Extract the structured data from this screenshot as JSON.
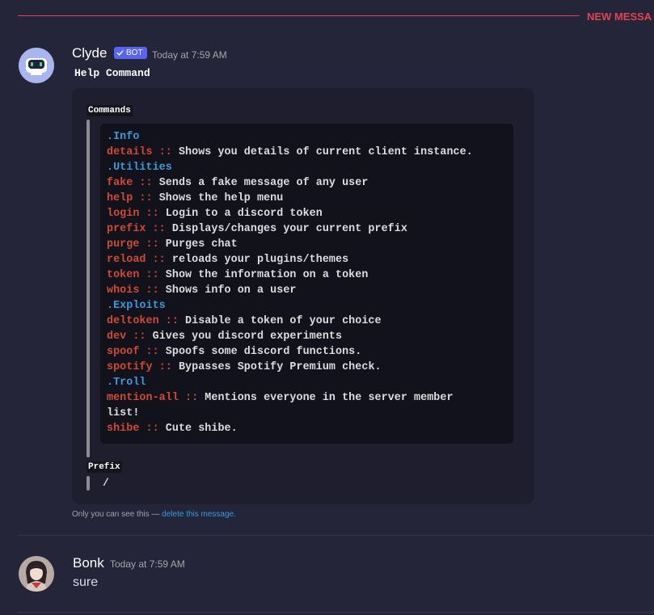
{
  "divider": {
    "label": "NEW MESSA"
  },
  "messages": {
    "bot": {
      "username": "Clyde",
      "badge": "BOT",
      "timestamp": "Today at 7:59 AM",
      "title": "Help Command",
      "embed": {
        "fields": {
          "commands": "Commands",
          "prefix": "Prefix"
        },
        "prefix_value": "/",
        "lines": [
          {
            "kind": "category",
            "text": ".Info"
          },
          {
            "kind": "command",
            "cmd": "details",
            "sep": " :: ",
            "desc": "Shows you details of current client instance."
          },
          {
            "kind": "category",
            "text": ".Utilities"
          },
          {
            "kind": "command",
            "cmd": "fake",
            "sep": " :: ",
            "desc": "Sends a fake message of any user"
          },
          {
            "kind": "command",
            "cmd": "help",
            "sep": " :: ",
            "desc": "Shows the help menu"
          },
          {
            "kind": "command",
            "cmd": "login",
            "sep": " :: ",
            "desc": "Login to a discord token"
          },
          {
            "kind": "command",
            "cmd": "prefix",
            "sep": " :: ",
            "desc": "Displays/changes your current prefix"
          },
          {
            "kind": "command",
            "cmd": "purge",
            "sep": " :: ",
            "desc": "Purges chat"
          },
          {
            "kind": "command",
            "cmd": "reload",
            "sep": " :: ",
            "desc": "reloads your plugins/themes"
          },
          {
            "kind": "command",
            "cmd": "token",
            "sep": " :: ",
            "desc": "Show the information on a token"
          },
          {
            "kind": "command",
            "cmd": "whois",
            "sep": " :: ",
            "desc": "Shows info on a user"
          },
          {
            "kind": "category",
            "text": ".Exploits"
          },
          {
            "kind": "command",
            "cmd": "deltoken",
            "sep": " :: ",
            "desc": "Disable a token of your choice"
          },
          {
            "kind": "command",
            "cmd": "dev",
            "sep": " :: ",
            "desc": "Gives you discord experiments"
          },
          {
            "kind": "command",
            "cmd": "spoof",
            "sep": " :: ",
            "desc": "Spoofs some discord functions."
          },
          {
            "kind": "command",
            "cmd": "spotify",
            "sep": " :: ",
            "desc": "Bypasses Spotify Premium check."
          },
          {
            "kind": "category",
            "text": ".Troll"
          },
          {
            "kind": "command",
            "cmd": "mention-all",
            "sep": " :: ",
            "desc": "Mentions everyone in the server member"
          },
          {
            "kind": "plain",
            "text": "list!"
          },
          {
            "kind": "command",
            "cmd": "shibe",
            "sep": " :: ",
            "desc": "Cute shibe."
          }
        ]
      },
      "ephemeral": {
        "text": "Only you can see this — ",
        "link": "delete this message."
      }
    },
    "user": {
      "username": "Bonk",
      "timestamp": "Today at 7:59 AM",
      "content": "sure"
    }
  },
  "colors": {
    "background": "#25253a",
    "embed": "#1e1e2e",
    "codeblock": "#12121c",
    "category": "#3b9bd9",
    "command": "#d14a33",
    "new_divider": "#e0434f",
    "bot_badge": "#5865f2",
    "link": "#2f9be8"
  },
  "icons": {
    "bot_avatar": "robot-avatar-icon",
    "badge_check": "checkmark-icon"
  }
}
